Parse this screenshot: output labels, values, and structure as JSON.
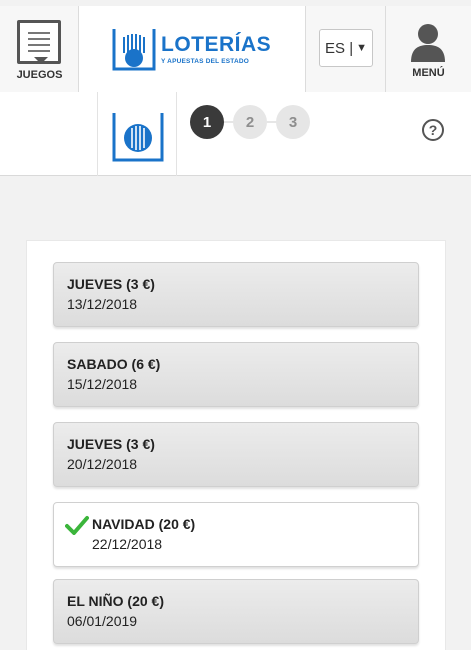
{
  "header": {
    "juegos_label": "JUEGOS",
    "logo_title": "LOTERÍAS",
    "logo_subtitle": "Y APUESTAS DEL ESTADO",
    "language": "ES |",
    "language_caret": "▼",
    "menu_label": "MENÚ"
  },
  "stepper": {
    "steps": [
      "1",
      "2",
      "3"
    ],
    "active": 1
  },
  "help": {
    "icon": "question-circle-icon",
    "glyph": "?"
  },
  "draws": [
    {
      "name": "JUEVES (3 €)",
      "date": "13/12/2018",
      "selected": false
    },
    {
      "name": "SABADO (6 €)",
      "date": "15/12/2018",
      "selected": false
    },
    {
      "name": "JUEVES (3 €)",
      "date": "20/12/2018",
      "selected": false
    },
    {
      "name": "NAVIDAD (20 €)",
      "date": "22/12/2018",
      "selected": true
    },
    {
      "name": "EL NIÑO (20 €)",
      "date": "06/01/2019",
      "selected": false
    }
  ],
  "colors": {
    "brand_blue": "#1a73c9",
    "check_green": "#3bb53b",
    "step_active": "#3a3a3a"
  }
}
